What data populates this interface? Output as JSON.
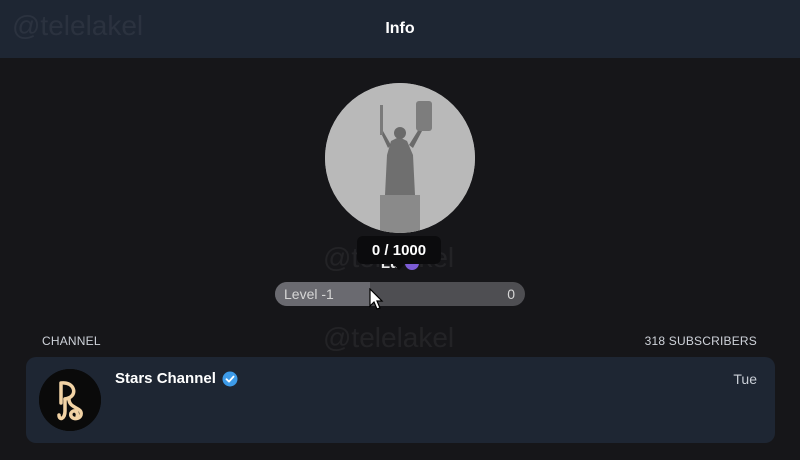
{
  "watermark": "@telelakel",
  "header": {
    "title": "Info"
  },
  "profile": {
    "avatar_icon": "statue-avatar",
    "name_partial": "Lu",
    "badge_color": "#7c5cd6",
    "tooltip": "0 / 1000",
    "level": {
      "label": "Level  -1",
      "value": "0",
      "progress": 0.38
    }
  },
  "section": {
    "left_label": "CHANNEL",
    "right_label": "318 SUBSCRIBERS"
  },
  "channel": {
    "name": "Stars Channel",
    "date": "Tue",
    "verified_icon": "verified-badge-icon",
    "avatar_icon": "stars-logo-icon",
    "accent": "#f2d3a5"
  },
  "colors": {
    "header_bg": "#1e2633",
    "page_bg": "#161619",
    "card_bg": "#1e2633",
    "verified": "#3d9be9"
  }
}
